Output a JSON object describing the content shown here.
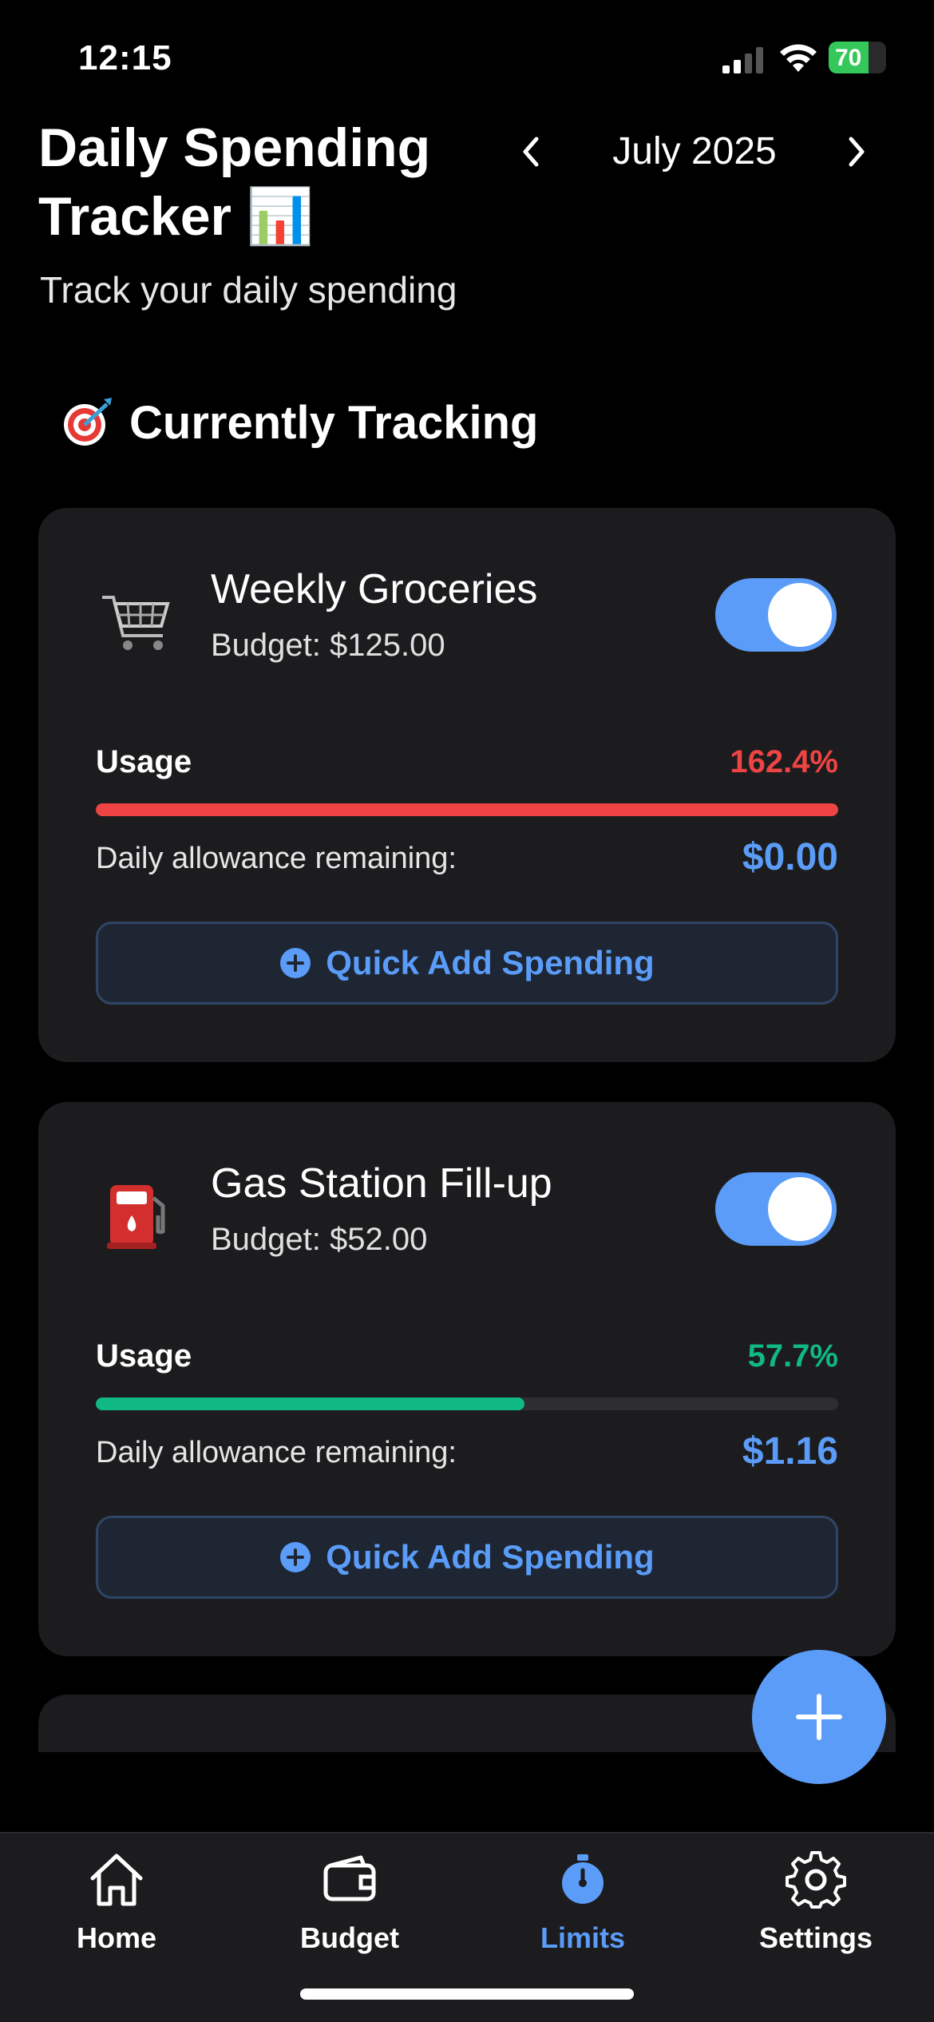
{
  "status_bar": {
    "time": "12:15",
    "battery": "70",
    "battery_fraction": 0.7
  },
  "header": {
    "title": "Daily Spending Tracker 📊",
    "subtitle": "Track your daily spending",
    "month": "July 2025"
  },
  "section": {
    "title": "Currently Tracking",
    "icon": "target-icon"
  },
  "cards": [
    {
      "name": "Weekly Groceries",
      "budget": "Budget: $125.00",
      "icon": "shopping-cart-icon",
      "enabled": true,
      "usage_label": "Usage",
      "usage_value": "162.4%",
      "usage_fraction": 1.0,
      "usage_color": "#ef4444",
      "allowance_label": "Daily allowance remaining:",
      "allowance_value": "$0.00",
      "button_label": "Quick Add Spending"
    },
    {
      "name": "Gas Station Fill-up",
      "budget": "Budget: $52.00",
      "icon": "fuel-pump-icon",
      "enabled": true,
      "usage_label": "Usage",
      "usage_value": "57.7%",
      "usage_fraction": 0.577,
      "usage_color": "#10b981",
      "allowance_label": "Daily allowance remaining:",
      "allowance_value": "$1.16",
      "button_label": "Quick Add Spending"
    }
  ],
  "tabs": [
    {
      "label": "Home",
      "icon": "home-icon",
      "active": false
    },
    {
      "label": "Budget",
      "icon": "wallet-icon",
      "active": false
    },
    {
      "label": "Limits",
      "icon": "timer-icon",
      "active": true
    },
    {
      "label": "Settings",
      "icon": "gear-icon",
      "active": false
    }
  ],
  "colors": {
    "accent": "#5a9cf8",
    "card": "#1c1c1e",
    "background": "#000000"
  }
}
